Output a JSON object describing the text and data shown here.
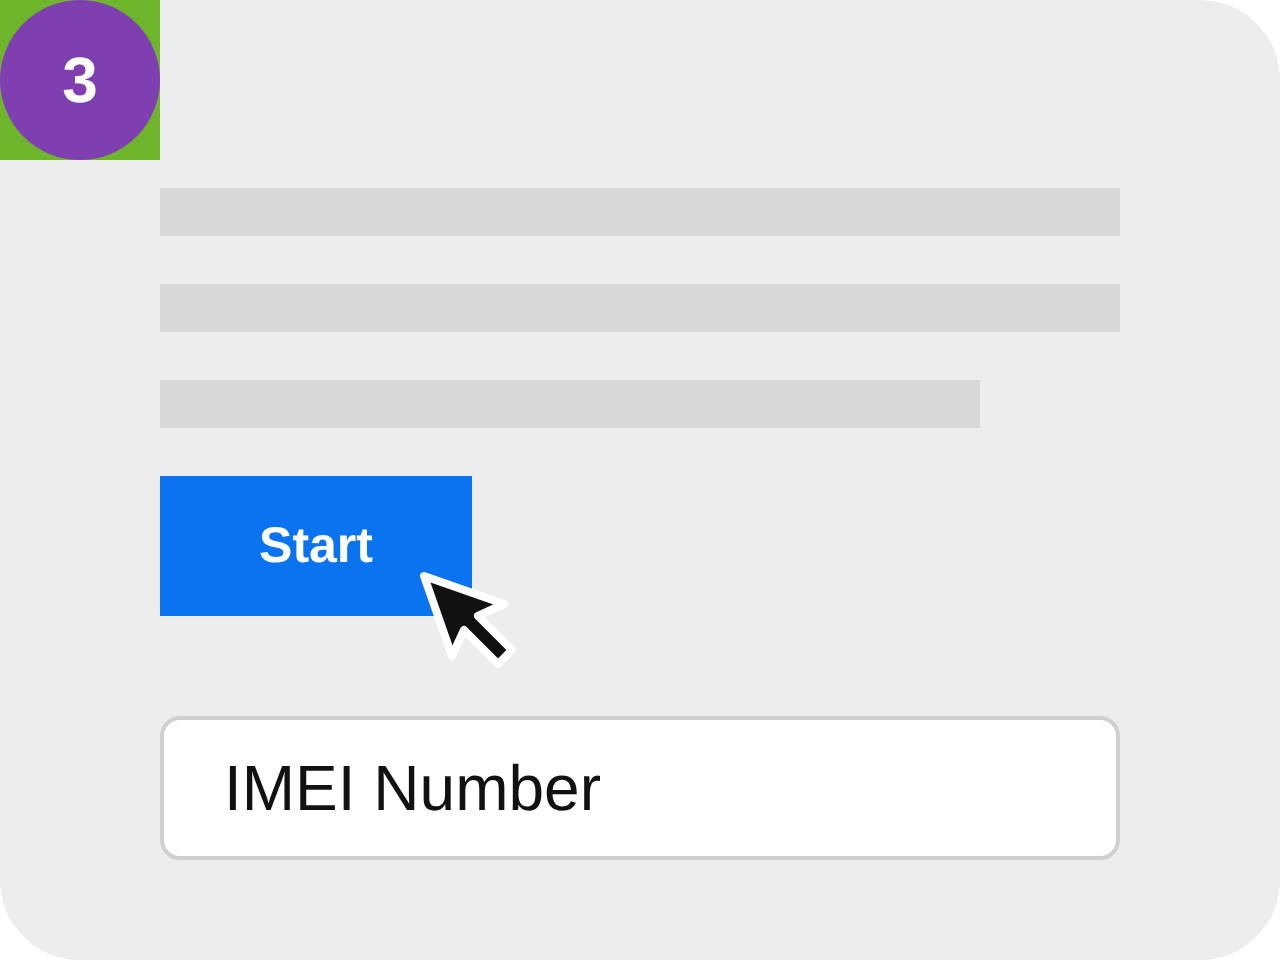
{
  "step_badge": {
    "label": "3"
  },
  "start_button": {
    "label": "Start"
  },
  "imei_field": {
    "value": "IMEI Number"
  }
}
